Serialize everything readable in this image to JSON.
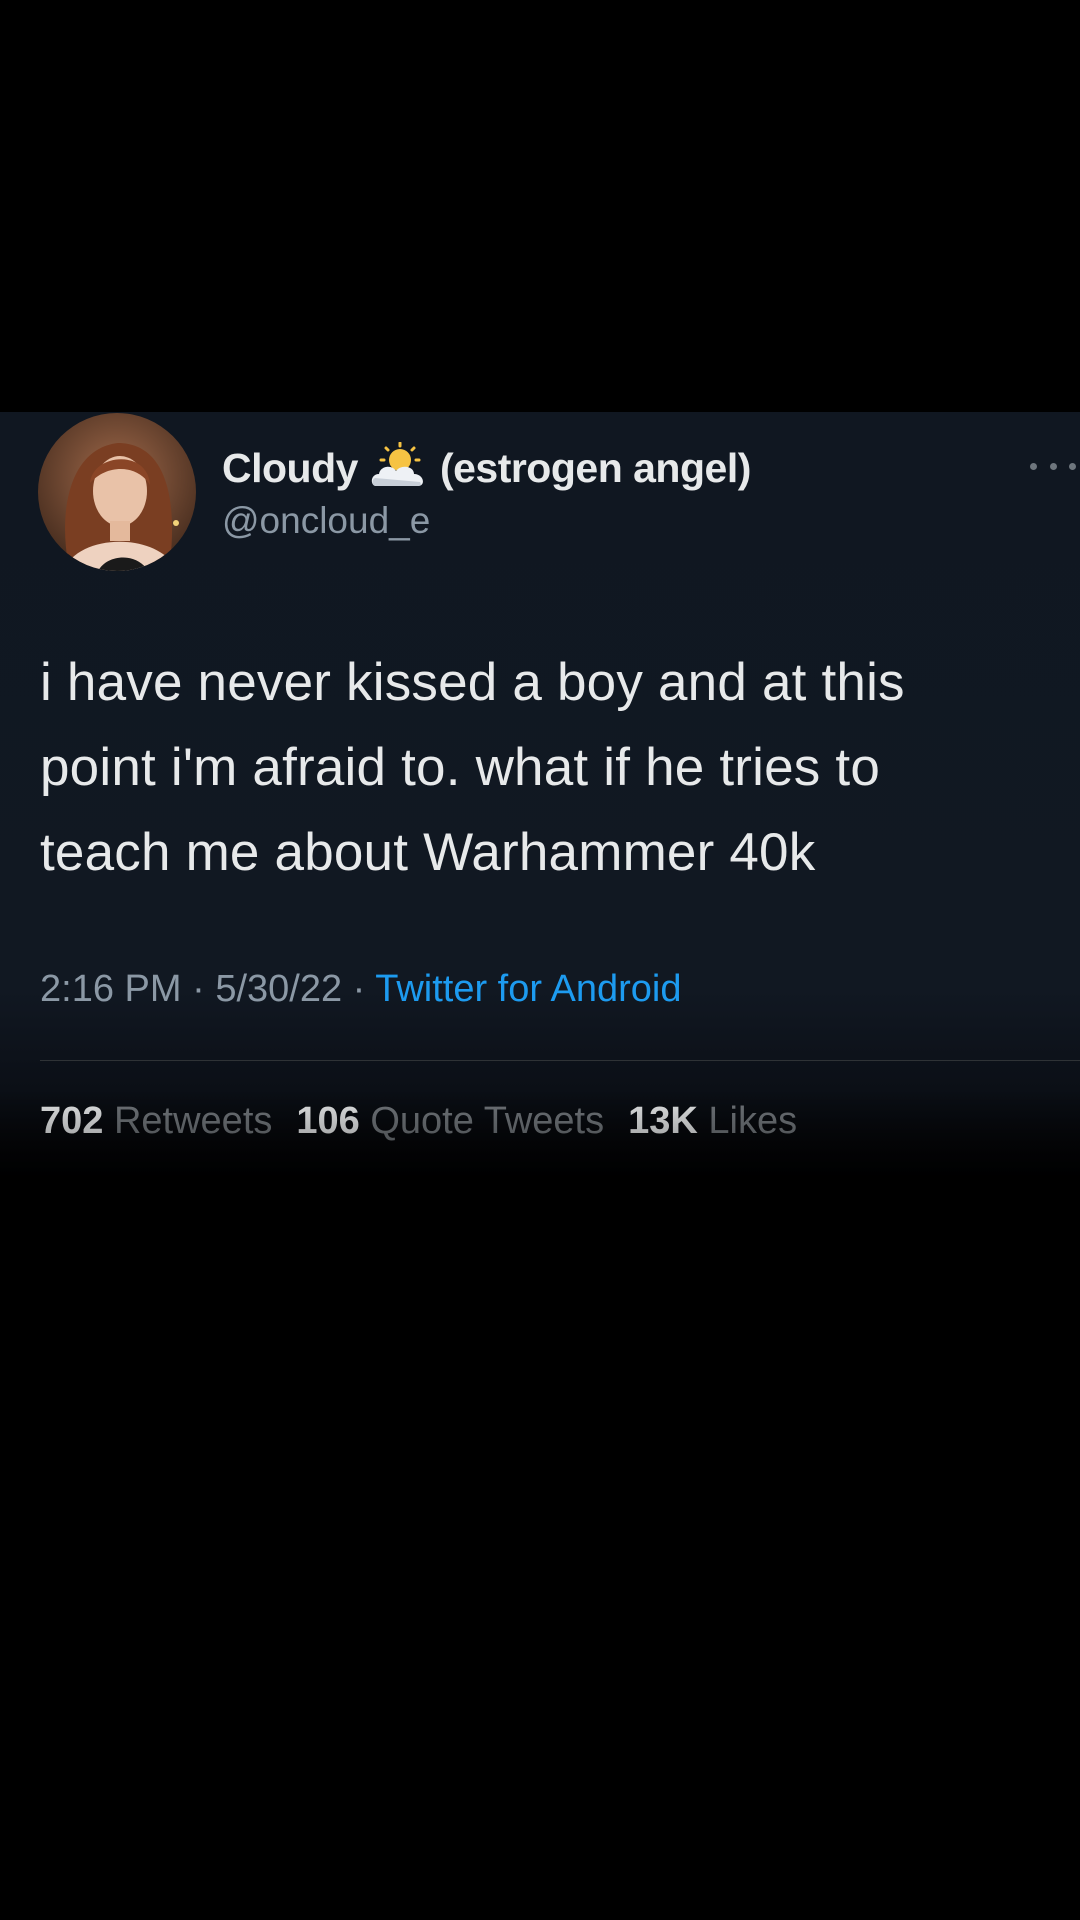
{
  "tweet": {
    "author": {
      "display_name_first": "Cloudy",
      "name_emoji_icon": "sun-behind-cloud-icon",
      "display_name_rest": "(estrogen angel)",
      "handle": "@oncloud_e"
    },
    "text": "i have never kissed a boy and at this\npoint i'm afraid to. what if he tries to\nteach me about Warhammer 40k",
    "time": "2:16 PM",
    "date": "5/30/22",
    "separator": "·",
    "source": "Twitter for Android",
    "stats": {
      "retweets_count": "702",
      "retweets_label": "Retweets",
      "quote_tweets_count": "106",
      "quote_tweets_label": "Quote Tweets",
      "likes_count": "13K",
      "likes_label": "Likes"
    }
  },
  "colors": {
    "background": "#000000",
    "card": "#111822",
    "primary_text": "#e7e9ea",
    "secondary_text": "#8b98a5",
    "link": "#1d9bf0"
  }
}
